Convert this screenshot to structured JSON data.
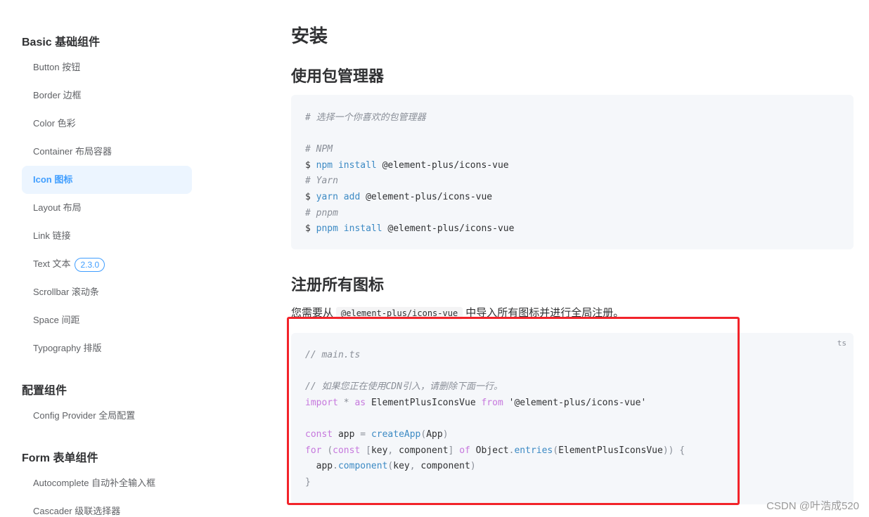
{
  "sidebar": {
    "groups": [
      {
        "title": "Basic 基础组件",
        "items": [
          {
            "label": "Button 按钮"
          },
          {
            "label": "Border 边框"
          },
          {
            "label": "Color 色彩"
          },
          {
            "label": "Container 布局容器"
          },
          {
            "label": "Icon 图标",
            "active": true
          },
          {
            "label": "Layout 布局"
          },
          {
            "label": "Link 链接"
          },
          {
            "label": "Text 文本",
            "badge": "2.3.0"
          },
          {
            "label": "Scrollbar 滚动条"
          },
          {
            "label": "Space 间距"
          },
          {
            "label": "Typography 排版"
          }
        ]
      },
      {
        "title": "配置组件",
        "items": [
          {
            "label": "Config Provider 全局配置"
          }
        ]
      },
      {
        "title": "Form 表单组件",
        "items": [
          {
            "label": "Autocomplete 自动补全输入框"
          },
          {
            "label": "Cascader 级联选择器"
          }
        ]
      }
    ]
  },
  "main": {
    "title": "安装",
    "section_package": {
      "heading": "使用包管理器",
      "code": {
        "comment_choose": "# 选择一个你喜欢的包管理器",
        "comment_npm": "# NPM",
        "npm_line": {
          "prompt": "$",
          "cmd": "npm install",
          "arg": "@element-plus/icons-vue"
        },
        "comment_yarn": "# Yarn",
        "yarn_line": {
          "prompt": "$",
          "cmd": "yarn add",
          "arg": "@element-plus/icons-vue"
        },
        "comment_pnpm": "# pnpm",
        "pnpm_line": {
          "prompt": "$",
          "cmd": "pnpm install",
          "arg": "@element-plus/icons-vue"
        }
      }
    },
    "section_register": {
      "heading": "注册所有图标",
      "para_before": "您需要从",
      "para_code": "@element-plus/icons-vue",
      "para_after": "中导入所有图标并进行全局注册。",
      "code": {
        "lang": "ts",
        "comment_file": "// main.ts",
        "comment_cdn": "// 如果您正在使用CDN引入，请删除下面一行。",
        "import_kw": "import",
        "import_star": "*",
        "import_as": "as",
        "import_name": "ElementPlusIconsVue",
        "import_from": "from",
        "import_src": "'@element-plus/icons-vue'",
        "const_kw": "const",
        "app_var": "app",
        "eq": "=",
        "create_fn": "createApp",
        "create_arg": "App",
        "for_kw": "for",
        "for_const": "const",
        "key": "key",
        "component": "component",
        "of_kw": "of",
        "object": "Object",
        "entries_fn": "entries",
        "entries_arg": "ElementPlusIconsVue",
        "app_component_obj": "app",
        "app_component_fn": "component",
        "close_brace": "}"
      }
    }
  },
  "watermark": "CSDN @叶浩成520",
  "colors": {
    "accent": "#409eff",
    "highlight_box": "#f2232a",
    "code_bg": "#f5f7fa"
  }
}
